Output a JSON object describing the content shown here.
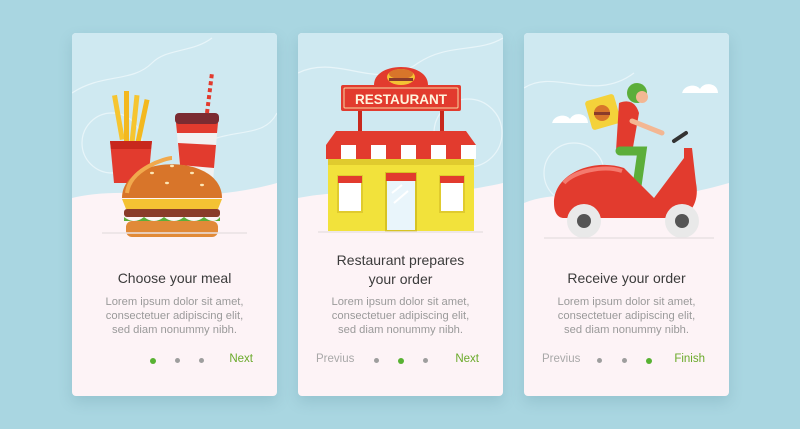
{
  "colors": {
    "background": "#a9d6e1",
    "card": "#fdf3f6",
    "accent_green": "#58b232",
    "button_green": "#6aaa2a",
    "muted_text": "#9a9a9a"
  },
  "cards": [
    {
      "illustration": "fast-food-meal",
      "title": "Choose your meal",
      "body": [
        "Lorem ipsum dolor sit amet,",
        "consectetuer adipiscing elit,",
        "sed diam nonummy nibh."
      ],
      "prev_label": "",
      "next_label": "Next",
      "active_step": 1
    },
    {
      "illustration": "restaurant-building",
      "title_lines": [
        "Restaurant prepares",
        "your order"
      ],
      "sign_text": "RESTAURANT",
      "body": [
        "Lorem ipsum dolor sit amet,",
        "consectetuer adipiscing elit,",
        "sed diam nonummy nibh."
      ],
      "prev_label": "Previus",
      "next_label": "Next",
      "active_step": 2
    },
    {
      "illustration": "delivery-scooter",
      "title": "Receive your order",
      "body": [
        "Lorem ipsum dolor sit amet,",
        "consectetuer adipiscing elit,",
        "sed diam nonummy nibh."
      ],
      "prev_label": "Previus",
      "next_label": "Finish",
      "active_step": 3
    }
  ]
}
